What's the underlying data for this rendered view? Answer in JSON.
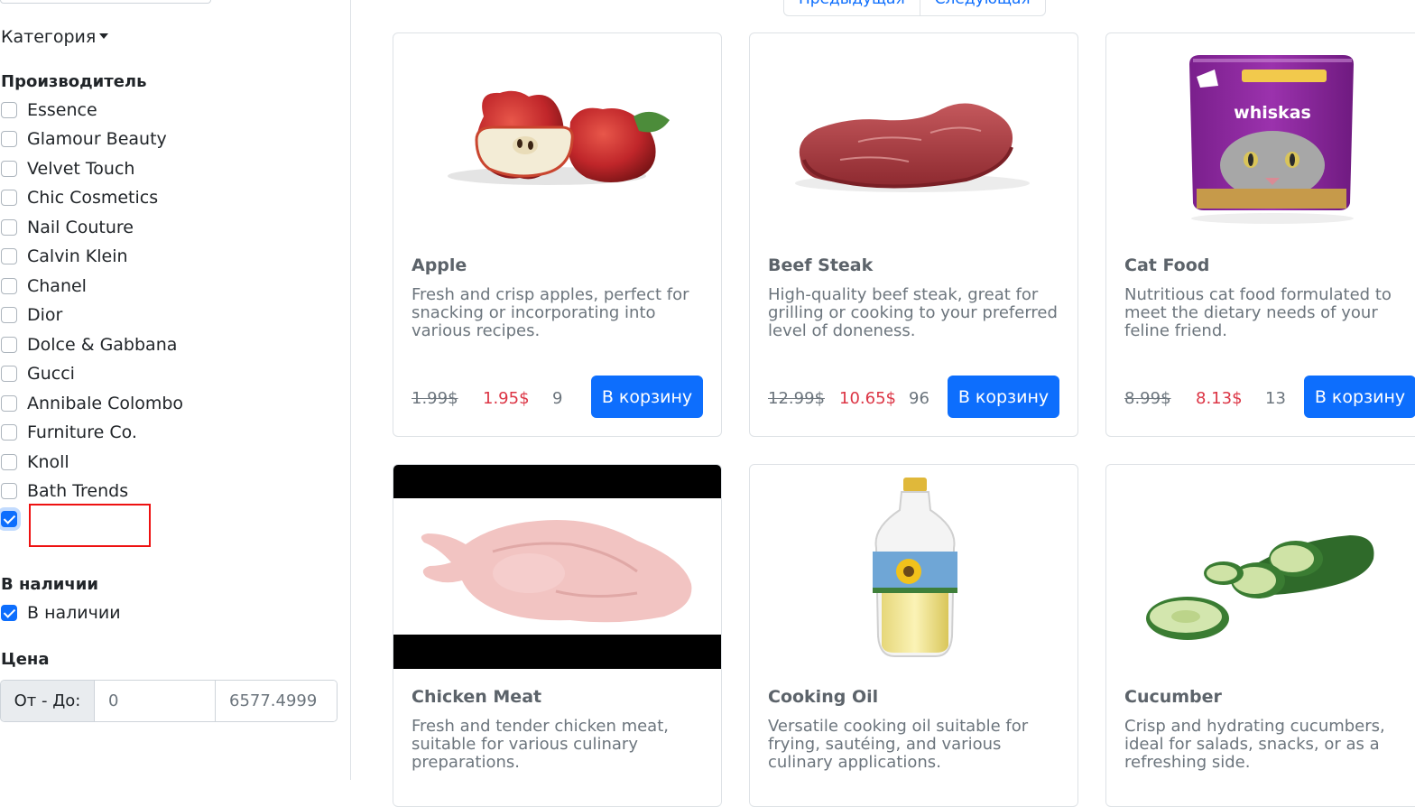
{
  "sidebar": {
    "category_label": "Категория",
    "manufacturer_title": "Производитель",
    "manufacturers": [
      {
        "label": "Essence",
        "checked": false
      },
      {
        "label": "Glamour Beauty",
        "checked": false
      },
      {
        "label": "Velvet Touch",
        "checked": false
      },
      {
        "label": "Chic Cosmetics",
        "checked": false
      },
      {
        "label": "Nail Couture",
        "checked": false
      },
      {
        "label": "Calvin Klein",
        "checked": false
      },
      {
        "label": "Chanel",
        "checked": false
      },
      {
        "label": "Dior",
        "checked": false
      },
      {
        "label": "Dolce & Gabbana",
        "checked": false
      },
      {
        "label": "Gucci",
        "checked": false
      },
      {
        "label": "Annibale Colombo",
        "checked": false
      },
      {
        "label": "Furniture Co.",
        "checked": false
      },
      {
        "label": "Knoll",
        "checked": false
      },
      {
        "label": "Bath Trends",
        "checked": false
      },
      {
        "label": "",
        "checked": true
      }
    ],
    "stock_title": "В наличии",
    "stock_option": {
      "label": "В наличии",
      "checked": true
    },
    "price_title": "Цена",
    "price_addon": "От - До:",
    "price_from": "0",
    "price_to": "6577.4999"
  },
  "pagination": {
    "prev": "Предыдущая",
    "next": "Следующая"
  },
  "colors": {
    "primary": "#0d6efd",
    "sale": "#dc3545",
    "highlight": "#ee1111"
  },
  "products": [
    {
      "title": "Apple",
      "description": "Fresh and crisp apples, perfect for snacking or incorporating into various recipes.",
      "old_price": "1.99$",
      "price": "1.95$",
      "stock": "9",
      "button": "В корзину",
      "image": "apple-image"
    },
    {
      "title": "Beef Steak",
      "description": "High-quality beef steak, great for grilling or cooking to your preferred level of doneness.",
      "old_price": "12.99$",
      "price": "10.65$",
      "stock": "96",
      "button": "В корзину",
      "image": "beef-steak-image"
    },
    {
      "title": "Cat Food",
      "description": "Nutritious cat food formulated to meet the dietary needs of your feline friend.",
      "old_price": "8.99$",
      "price": "8.13$",
      "stock": "13",
      "button": "В корзину",
      "image": "cat-food-image",
      "image_text": "whiskas"
    },
    {
      "title": "Chicken Meat",
      "description": "Fresh and tender chicken meat, suitable for various culinary preparations.",
      "image": "chicken-meat-image"
    },
    {
      "title": "Cooking Oil",
      "description": "Versatile cooking oil suitable for frying, sautéing, and various culinary applications.",
      "image": "cooking-oil-image"
    },
    {
      "title": "Cucumber",
      "description": "Crisp and hydrating cucumbers, ideal for salads, snacks, or as a refreshing side.",
      "image": "cucumber-image"
    }
  ]
}
